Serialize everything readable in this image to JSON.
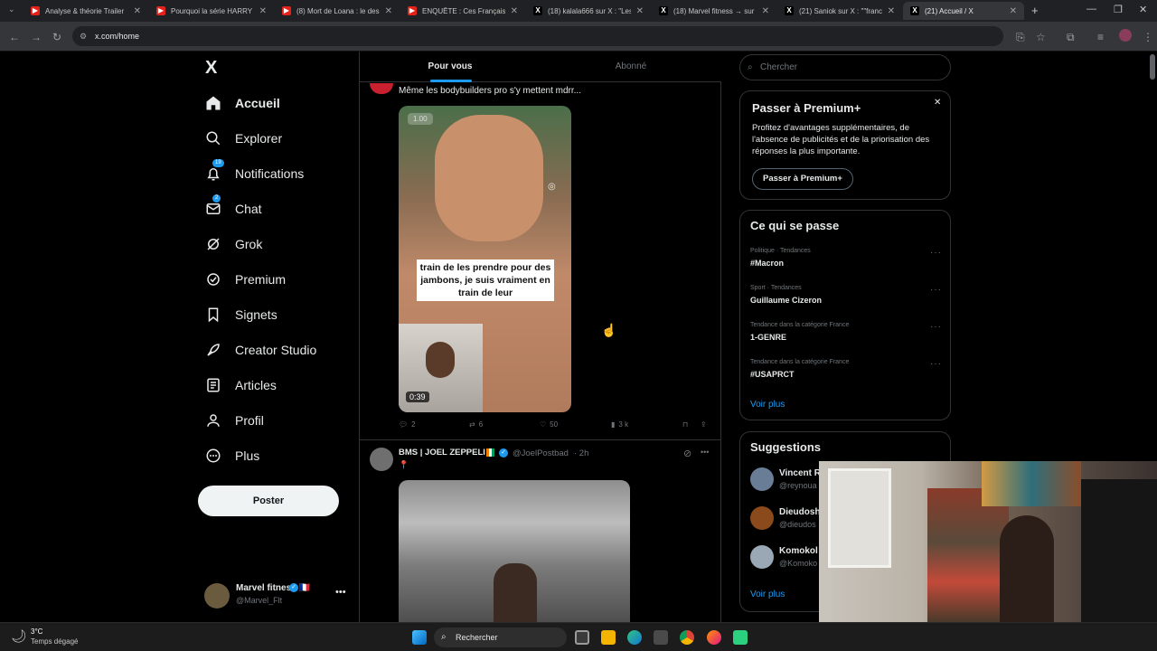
{
  "browser": {
    "tabs": [
      {
        "title": "Analyse & théorie Trailer",
        "icon": "youtube-icon"
      },
      {
        "title": "Pourquoi la série HARRY",
        "icon": "youtube-icon"
      },
      {
        "title": "(8) Mort de Loana : le des",
        "icon": "youtube-icon"
      },
      {
        "title": "ENQUÊTE : Ces Français p",
        "icon": "youtube-icon"
      },
      {
        "title": "(18) kalala666 sur X : \"Les",
        "icon": "x-icon"
      },
      {
        "title": "(18) Marvel fitness → sur",
        "icon": "x-icon"
      },
      {
        "title": "(21) Saniok sur X : \"\"franc",
        "icon": "x-icon"
      },
      {
        "title": "(21) Accueil / X",
        "icon": "x-icon"
      }
    ],
    "url": "x.com/home"
  },
  "sidebar": {
    "logo": "X",
    "items": [
      {
        "label": "Accueil",
        "icon": "home-icon"
      },
      {
        "label": "Explorer",
        "icon": "search-icon"
      },
      {
        "label": "Notifications",
        "icon": "bell-icon",
        "badge": "19"
      },
      {
        "label": "Chat",
        "icon": "mail-icon",
        "badge": "2"
      },
      {
        "label": "Grok",
        "icon": "grok-icon"
      },
      {
        "label": "Premium",
        "icon": "verified-icon"
      },
      {
        "label": "Signets",
        "icon": "bookmark-icon"
      },
      {
        "label": "Creator Studio",
        "icon": "rocket-icon"
      },
      {
        "label": "Articles",
        "icon": "article-icon"
      },
      {
        "label": "Profil",
        "icon": "user-icon"
      },
      {
        "label": "Plus",
        "icon": "more-circle-icon"
      }
    ],
    "post_button": "Poster",
    "account": {
      "name": "Marvel fitness 🇫🇷",
      "handle": "@Marvel_Flt"
    }
  },
  "feed": {
    "tabs": [
      "Pour vous",
      "Abonné"
    ],
    "post1": {
      "text": "Même les bodybuilders pro s'y mettent mdrr...",
      "video_rate": "1.00",
      "video_caption": "train de les prendre pour des jambons, je suis vraiment en train de leur",
      "video_duration": "0:39",
      "stats": {
        "replies": "2",
        "reposts": "6",
        "likes": "50",
        "views": "3 k"
      }
    },
    "post2": {
      "author": "BMS | JOEL ZEPPELI",
      "handle": "@JoelPostbad",
      "time": "· 2h",
      "text": "📍"
    }
  },
  "right": {
    "search_placeholder": "Chercher",
    "premium": {
      "title": "Passer à Premium+",
      "body": "Profitez d'avantages supplémentaires, de l'absence de publicités et de la priorisation des réponses la plus importante.",
      "button": "Passer à Premium+"
    },
    "trends": {
      "title": "Ce qui se passe",
      "items": [
        {
          "meta": "Politique · Tendances",
          "name": "#Macron"
        },
        {
          "meta": "Sport · Tendances",
          "name": "Guillaume Cizeron"
        },
        {
          "meta": "Tendance dans la catégorie France",
          "name": "1-GENRE"
        },
        {
          "meta": "Tendance dans la catégorie France",
          "name": "#USAPRCT"
        }
      ],
      "more": "Voir plus"
    },
    "suggestions": {
      "title": "Suggestions",
      "items": [
        {
          "name": "Vincent R",
          "handle": "@reynoua"
        },
        {
          "name": "Dieudosh",
          "handle": "@dieudos"
        },
        {
          "name": "Komokol",
          "handle": "@Komoko"
        }
      ],
      "more": "Voir plus"
    }
  },
  "taskbar": {
    "temperature": "3°C",
    "weather": "Temps dégagé",
    "search": "Rechercher"
  }
}
